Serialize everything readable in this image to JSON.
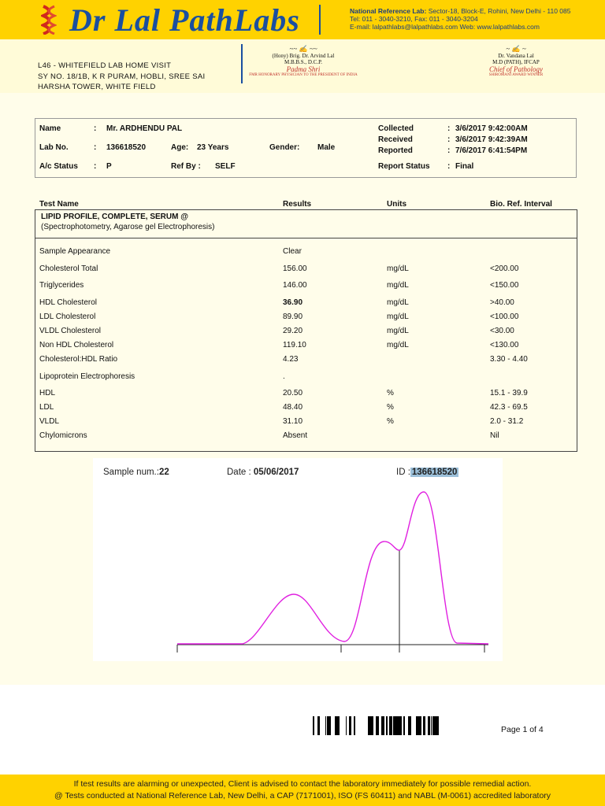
{
  "header": {
    "brand": "Dr Lal PathLabs",
    "national_lab": {
      "label": "National Reference Lab:",
      "address": "Sector-18, Block-E, Rohini, New Delhi - 110 085",
      "tel": "Tel: 011 - 3040-3210, Fax: 011 - 3040-3204",
      "email_web": "E-mail: lalpathlabs@lalpathlabs.com Web: www.lalpathlabs.com"
    }
  },
  "lab_address": [
    "L46 - WHITEFIELD LAB HOME VISIT",
    "SY NO. 18/1B, K R PURAM, HOBLI, SREE SAI",
    "HARSHA TOWER, WHITE FIELD"
  ],
  "signatories": [
    {
      "signature": "Arvind Lal",
      "name": "(Hony) Brig. Dr. Arvind Lal",
      "quals": "M.B.B.S., D.C.P.",
      "award": "Padma Shri",
      "note": "FMR HONORARY PHYSICIAN TO THE PRESIDENT OF INDIA"
    },
    {
      "signature": "Vandana Lal",
      "name": "Dr. Vandana Lal",
      "quals": "M.D (PATH), IFCAP",
      "award": "Chief of Pathology",
      "note": "SHIROMANI AWARD WINNER"
    }
  ],
  "patient": {
    "name_label": "Name",
    "name": "Mr. ARDHENDU  PAL",
    "labno_label": "Lab No.",
    "labno": "136618520",
    "age_label": "Age:",
    "age": "23 Years",
    "gender_label": "Gender:",
    "gender": "Male",
    "ac_label": "A/c Status",
    "ac": "P",
    "ref_label": "Ref By :",
    "ref": "SELF",
    "collected_label": "Collected",
    "collected": "3/6/2017   9:42:00AM",
    "received_label": "Received",
    "received": "3/6/2017   9:42:39AM",
    "reported_label": "Reported",
    "reported": "7/6/2017  6:41:54PM",
    "status_label": "Report Status",
    "status": "Final",
    "colon": ":"
  },
  "table": {
    "headers": [
      "Test Name",
      "Results",
      "Units",
      "Bio. Ref. Interval"
    ],
    "panel": "LIPID PROFILE, COMPLETE, SERUM @",
    "method": "(Spectrophotometry, Agarose gel Electrophoresis)",
    "rows": [
      [
        "Sample Appearance",
        "Clear",
        "",
        ""
      ],
      [
        "Cholesterol  Total",
        "156.00",
        "mg/dL",
        "<200.00"
      ],
      [
        "Triglycerides",
        "146.00",
        "mg/dL",
        "<150.00"
      ],
      [
        "HDL Cholesterol",
        "36.90",
        "mg/dL",
        ">40.00"
      ],
      [
        "LDL Cholesterol",
        "89.90",
        "mg/dL",
        "<100.00"
      ],
      [
        "VLDL Cholesterol",
        "29.20",
        "mg/dL",
        "<30.00"
      ],
      [
        "Non HDL Cholesterol",
        "119.10",
        "mg/dL",
        "<130.00"
      ],
      [
        "Cholesterol:HDL Ratio",
        "4.23",
        "",
        "3.30 - 4.40"
      ],
      [
        "Lipoprotein Electrophoresis",
        ".",
        "",
        ""
      ],
      [
        "HDL",
        "20.50",
        "%",
        "15.1 - 39.9"
      ],
      [
        "LDL",
        "48.40",
        "%",
        "42.3 - 69.5"
      ],
      [
        "VLDL",
        "31.10",
        "%",
        "2.0 - 31.2"
      ],
      [
        "Chylomicrons",
        "Absent",
        "",
        "Nil"
      ]
    ]
  },
  "electrophoresis": {
    "sample_label": "Sample num.:",
    "sample": "22",
    "date_label": "Date :",
    "date": "05/06/2017",
    "id_label": "ID :",
    "id": "136618520",
    "curve_color": "#e020e0"
  },
  "page": "Page 1 of 4",
  "footer": [
    "If test results are alarming or unexpected, Client is advised to contact the laboratory immediately for possible remedial action.",
    "@ Tests conducted at National Reference Lab, New Delhi, a CAP (7171001), ISO (FS 60411) and NABL (M-0061) accredited laboratory"
  ],
  "colors": {
    "brand_yellow": "#FFD200",
    "brand_blue": "#1a4fa0"
  }
}
